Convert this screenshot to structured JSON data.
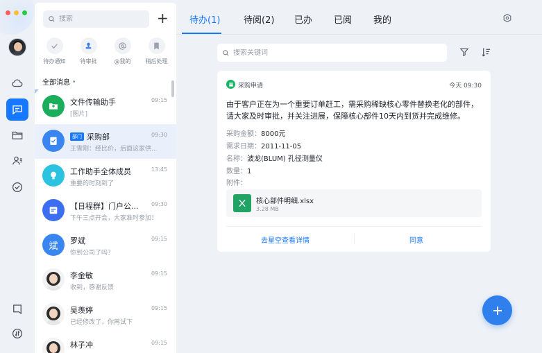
{
  "window": {
    "traffic_colors": [
      "#ff5f57",
      "#febc2e",
      "#28c840"
    ]
  },
  "rail": {
    "items": [
      {
        "name": "cloud-icon",
        "active": false
      },
      {
        "name": "message-icon",
        "active": true
      },
      {
        "name": "folder-icon",
        "active": false
      },
      {
        "name": "contacts-icon",
        "active": false
      },
      {
        "name": "check-circle-icon",
        "active": false
      },
      {
        "name": "bookmark-icon",
        "active": false
      },
      {
        "name": "sort-circle-icon",
        "active": false
      }
    ]
  },
  "list": {
    "search_placeholder": "搜索",
    "add_label": "+",
    "quick": [
      {
        "icon": "check-icon",
        "label": "待办通知"
      },
      {
        "icon": "stamp-icon",
        "label": "待审批"
      },
      {
        "icon": "at-icon",
        "label": "@我的"
      },
      {
        "icon": "bookmark-icon",
        "label": "稍后处理"
      }
    ],
    "filter_label": "全部消息",
    "filter_caret": "▾",
    "conversations": [
      {
        "name": "文件传输助手",
        "tag": "",
        "time": "09:15",
        "preview": "[图片]",
        "avatar_color": "#1aad5c",
        "avatar_icon": "folder-icon",
        "active": false
      },
      {
        "name": "采购部",
        "tag": "部门",
        "time": "09:30",
        "preview": "王雪刚：经比价，后面这家供...",
        "avatar_color": "#3a86f0",
        "avatar_icon": "clipboard-icon",
        "active": true
      },
      {
        "name": "工作助手全体成员",
        "tag": "",
        "time": "13:45",
        "preview": "重要的时刻到了",
        "avatar_color": "#2cc3e0",
        "avatar_icon": "bulb-icon",
        "active": false
      },
      {
        "name": "【日程群】门户公...",
        "tag": "",
        "time": "09:30",
        "preview": "下午三点开会，大家准时参加！",
        "avatar_color": "#3b6ef0",
        "avatar_icon": "calendar-icon",
        "active": false
      },
      {
        "name": "罗斌",
        "tag": "",
        "time": "09:15",
        "preview": "你到公司了吗？",
        "avatar_color": "#3a86f0",
        "avatar_text": "斌",
        "active": false
      },
      {
        "name": "李金敏",
        "tag": "",
        "time": "09:15",
        "preview": "收到，感谢反馈",
        "avatar_color": "#f3f3f3",
        "avatar_person": true,
        "active": false
      },
      {
        "name": "吴羡婷",
        "tag": "",
        "time": "09:15",
        "preview": "已经修改了，你再试下",
        "avatar_color": "#f3f3f3",
        "avatar_person": true,
        "active": false
      },
      {
        "name": "林子冲",
        "tag": "",
        "time": "09:15",
        "preview": "",
        "avatar_color": "#f3f3f3",
        "avatar_person": true,
        "active": false
      }
    ]
  },
  "main": {
    "tabs": [
      {
        "label": "待办(1)",
        "active": true
      },
      {
        "label": "待阅(2)",
        "active": false
      },
      {
        "label": "已办",
        "active": false
      },
      {
        "label": "已阅",
        "active": false
      },
      {
        "label": "我的",
        "active": false
      }
    ],
    "keyword_placeholder": "搜索关键词",
    "card": {
      "type_label": "采购申请",
      "time": "今天 09:30",
      "body": "由于客户正在为一个重要订单赶工，需采购稀缺核心零件替换老化的部件，请大家及时审批，并关注进展，保障核心部件10天内到货并完成维修。",
      "fields": [
        {
          "k": "采购金额：",
          "v": "8000元"
        },
        {
          "k": "需求日期：",
          "v": "2011-11-05"
        },
        {
          "k": "名称：",
          "v": "波龙(BLUM) 孔径测量仪"
        },
        {
          "k": "数量：",
          "v": "1"
        },
        {
          "k": "附件：",
          "v": ""
        }
      ],
      "attachment": {
        "name": "核心部件明细.xlsx",
        "size": "3.28 MB"
      },
      "actions": {
        "detail": "去星空查看详情",
        "approve": "同意"
      }
    },
    "fab_label": "+",
    "accent": "#1677ff"
  }
}
